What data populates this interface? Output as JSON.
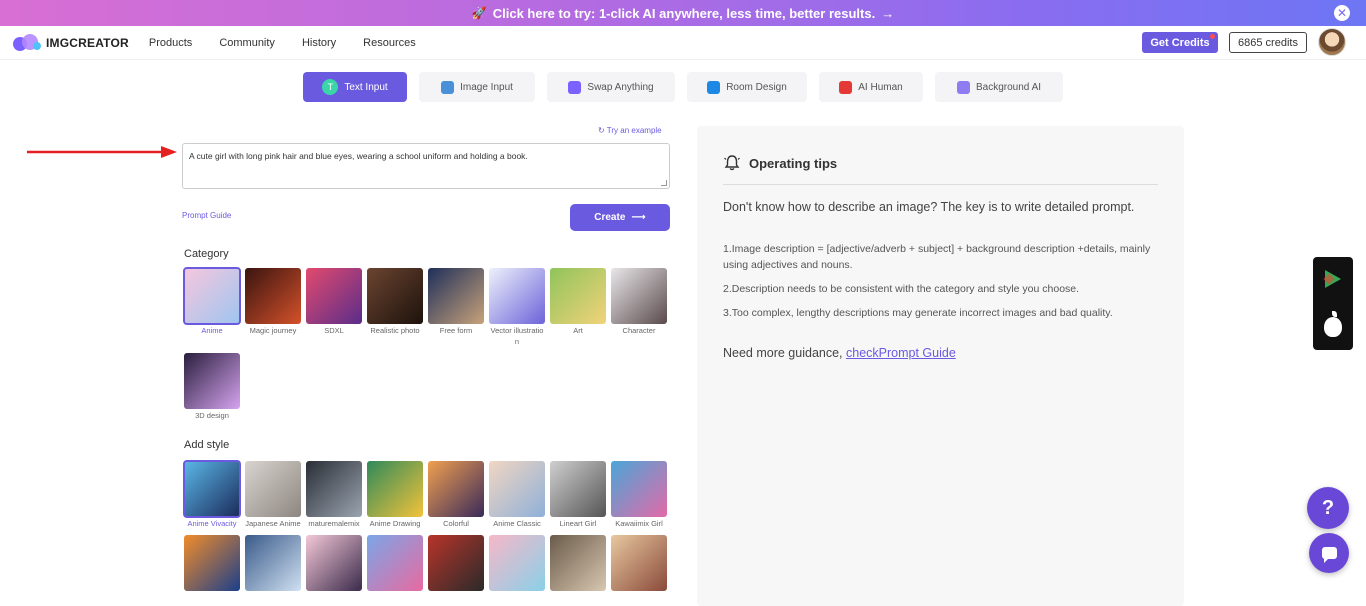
{
  "promo": {
    "text": "Click here to try: 1-click AI anywhere, less time, better results.",
    "arrow": "→",
    "close": "✕"
  },
  "nav": {
    "logo": "IMGCREATOR",
    "menu": [
      "Products",
      "Community",
      "History",
      "Resources"
    ],
    "get_credits": "Get Credits",
    "credits": "6865 credits"
  },
  "tabs": [
    {
      "label": "Text Input",
      "icon": "T",
      "color": "#3ad6a8"
    },
    {
      "label": "Image Input",
      "color": "#4a90d9"
    },
    {
      "label": "Swap Anything",
      "color": "#7b61ff"
    },
    {
      "label": "Room Design",
      "color": "#1e88e5"
    },
    {
      "label": "AI Human",
      "color": "#e53935"
    },
    {
      "label": "Background AI",
      "color": "#8e7cf0"
    }
  ],
  "prompt": {
    "try_example": "Try an example",
    "value": "A cute girl with long pink hair and blue eyes, wearing a school uniform and holding a book.",
    "guide": "Prompt Guide",
    "create": "Create"
  },
  "category": {
    "title": "Category",
    "items": [
      {
        "label": "Anime",
        "c1": "#f6c6dd",
        "c2": "#9ec5f0"
      },
      {
        "label": "Magic journey",
        "c1": "#3a1410",
        "c2": "#d4512a"
      },
      {
        "label": "SDXL",
        "c1": "#e24a6e",
        "c2": "#5a2d8a"
      },
      {
        "label": "Realistic photo",
        "c1": "#6b4430",
        "c2": "#1d120c"
      },
      {
        "label": "Free form",
        "c1": "#1f2f5a",
        "c2": "#c7a27a"
      },
      {
        "label": "Vector illustration",
        "c1": "#eef1fb",
        "c2": "#6c63d9"
      },
      {
        "label": "Art",
        "c1": "#8fc45b",
        "c2": "#f2d27a"
      },
      {
        "label": "Character",
        "c1": "#e9e7ea",
        "c2": "#5a4a4c"
      },
      {
        "label": "3D design",
        "c1": "#2a1e3e",
        "c2": "#d6a4f0"
      }
    ]
  },
  "style": {
    "title": "Add style",
    "items": [
      {
        "label": "Anime Vivacity",
        "c1": "#5bb8e8",
        "c2": "#1a2a5a"
      },
      {
        "label": "Japanese Anime",
        "c1": "#d9d4d0",
        "c2": "#8d8680"
      },
      {
        "label": "maturemalemix",
        "c1": "#2a2e36",
        "c2": "#9aa4b0"
      },
      {
        "label": "Anime Drawing",
        "c1": "#2f8a5a",
        "c2": "#f3c23a"
      },
      {
        "label": "Colorful",
        "c1": "#f0a050",
        "c2": "#3a2a5a"
      },
      {
        "label": "Anime Classic",
        "c1": "#f1d6c2",
        "c2": "#8fb0d8"
      },
      {
        "label": "Lineart Girl",
        "c1": "#cfcfcf",
        "c2": "#555555"
      },
      {
        "label": "Kawaiimix Girl",
        "c1": "#4aa6d8",
        "c2": "#e26aa8"
      },
      {
        "label": "",
        "c1": "#f28c2a",
        "c2": "#1b3f8a"
      },
      {
        "label": "",
        "c1": "#3a5a8a",
        "c2": "#cfe0f0"
      },
      {
        "label": "",
        "c1": "#f4c8d8",
        "c2": "#3a2a4a"
      },
      {
        "label": "",
        "c1": "#7aa6e8",
        "c2": "#e86aa0"
      },
      {
        "label": "",
        "c1": "#b8342a",
        "c2": "#2a2a2a"
      },
      {
        "label": "",
        "c1": "#f7b7c8",
        "c2": "#8ad0e8"
      },
      {
        "label": "",
        "c1": "#6a5a4a",
        "c2": "#d8c8b0"
      },
      {
        "label": "",
        "c1": "#e8c8a0",
        "c2": "#8a4a3a"
      }
    ]
  },
  "tips": {
    "title": "Operating tips",
    "intro": "Don't know how to describe an image? The key is to write detailed prompt.",
    "items": [
      "1.Image description = [adjective/adverb + subject] + background description +details, mainly using adjectives and nouns.",
      "2.Description needs to be consistent with the category and style you choose.",
      "3.Too complex, lengthy descriptions may generate incorrect images and bad quality."
    ],
    "more_prefix": "Need more guidance, ",
    "more_link": "checkPrompt Guide"
  },
  "help": "?"
}
